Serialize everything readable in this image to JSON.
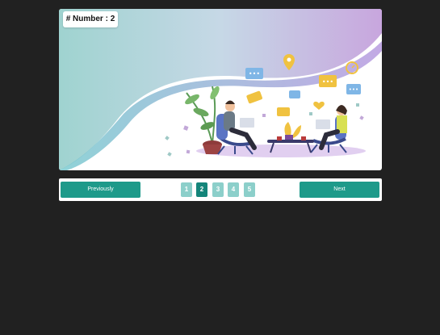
{
  "badge": {
    "text": "# Number : 2"
  },
  "pagination": {
    "previous_label": "Previously",
    "next_label": "Next",
    "pages": [
      "1",
      "2",
      "3",
      "4",
      "5"
    ],
    "active_page": 2
  },
  "colors": {
    "accent": "#1e9a8a",
    "page_active": "#14857a",
    "page_inactive": "#8ccfca",
    "background": "#212121"
  }
}
